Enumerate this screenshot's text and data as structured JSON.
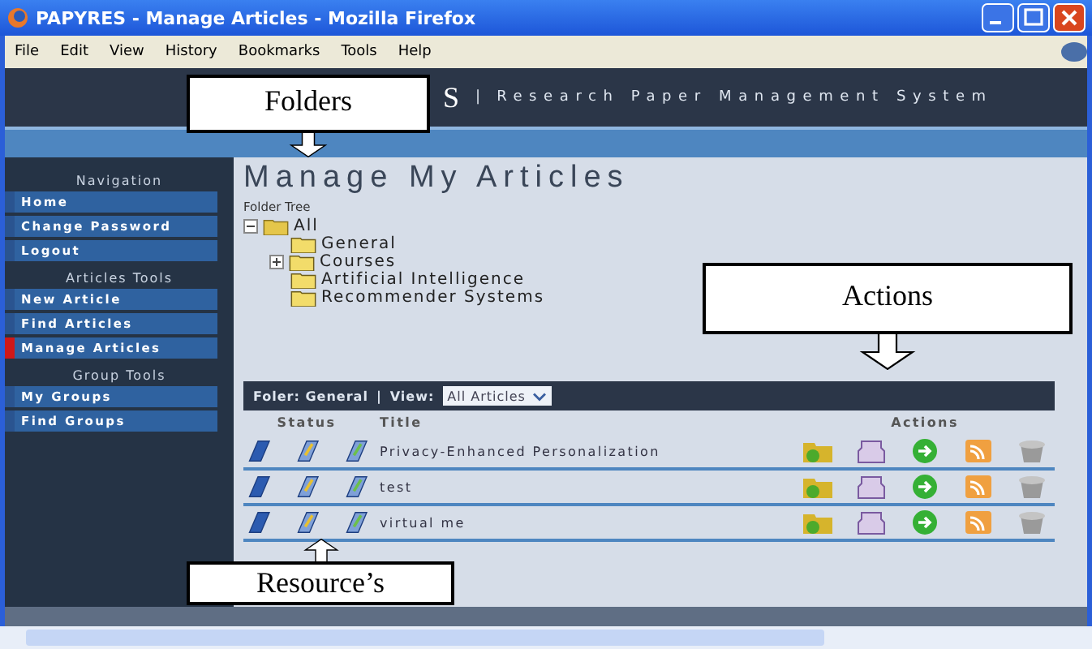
{
  "window": {
    "title": "PAPYRES - Manage Articles - Mozilla Firefox"
  },
  "menu": [
    "File",
    "Edit",
    "View",
    "History",
    "Bookmarks",
    "Tools",
    "Help"
  ],
  "header": {
    "brand": "S",
    "separator": "|",
    "tagline": "Research Paper Management System"
  },
  "sidebar": [
    {
      "title": "Navigation",
      "items": [
        {
          "label": "Home",
          "selected": false
        },
        {
          "label": "Change Password",
          "selected": false
        },
        {
          "label": "Logout",
          "selected": false
        }
      ]
    },
    {
      "title": "Articles Tools",
      "items": [
        {
          "label": "New Article",
          "selected": false
        },
        {
          "label": "Find Articles",
          "selected": false
        },
        {
          "label": "Manage Articles",
          "selected": true
        }
      ]
    },
    {
      "title": "Group Tools",
      "items": [
        {
          "label": "My Groups",
          "selected": false
        },
        {
          "label": "Find Groups",
          "selected": false
        }
      ]
    }
  ],
  "heading": "Manage My Articles",
  "tree_label": "Folder Tree",
  "tree": {
    "label": "All",
    "expanded": true,
    "children": [
      {
        "label": "General"
      },
      {
        "label": "Courses",
        "expanded": false
      },
      {
        "label": "Artificial Intelligence"
      },
      {
        "label": "Recommender Systems"
      }
    ]
  },
  "toolbar": {
    "folder": "Foler: General",
    "separator": "|",
    "view_label": "View:",
    "view_value": "All Articles"
  },
  "table": {
    "columns": [
      "Status",
      "Title",
      "Actions"
    ],
    "rows": [
      {
        "title": "Privacy-Enhanced Personalization"
      },
      {
        "title": "test"
      },
      {
        "title": "virtual me"
      }
    ]
  },
  "callouts": [
    {
      "kind": "down",
      "text": "Folders"
    },
    {
      "kind": "down",
      "text": "Actions"
    },
    {
      "kind": "up",
      "text": "Resource’s"
    }
  ]
}
